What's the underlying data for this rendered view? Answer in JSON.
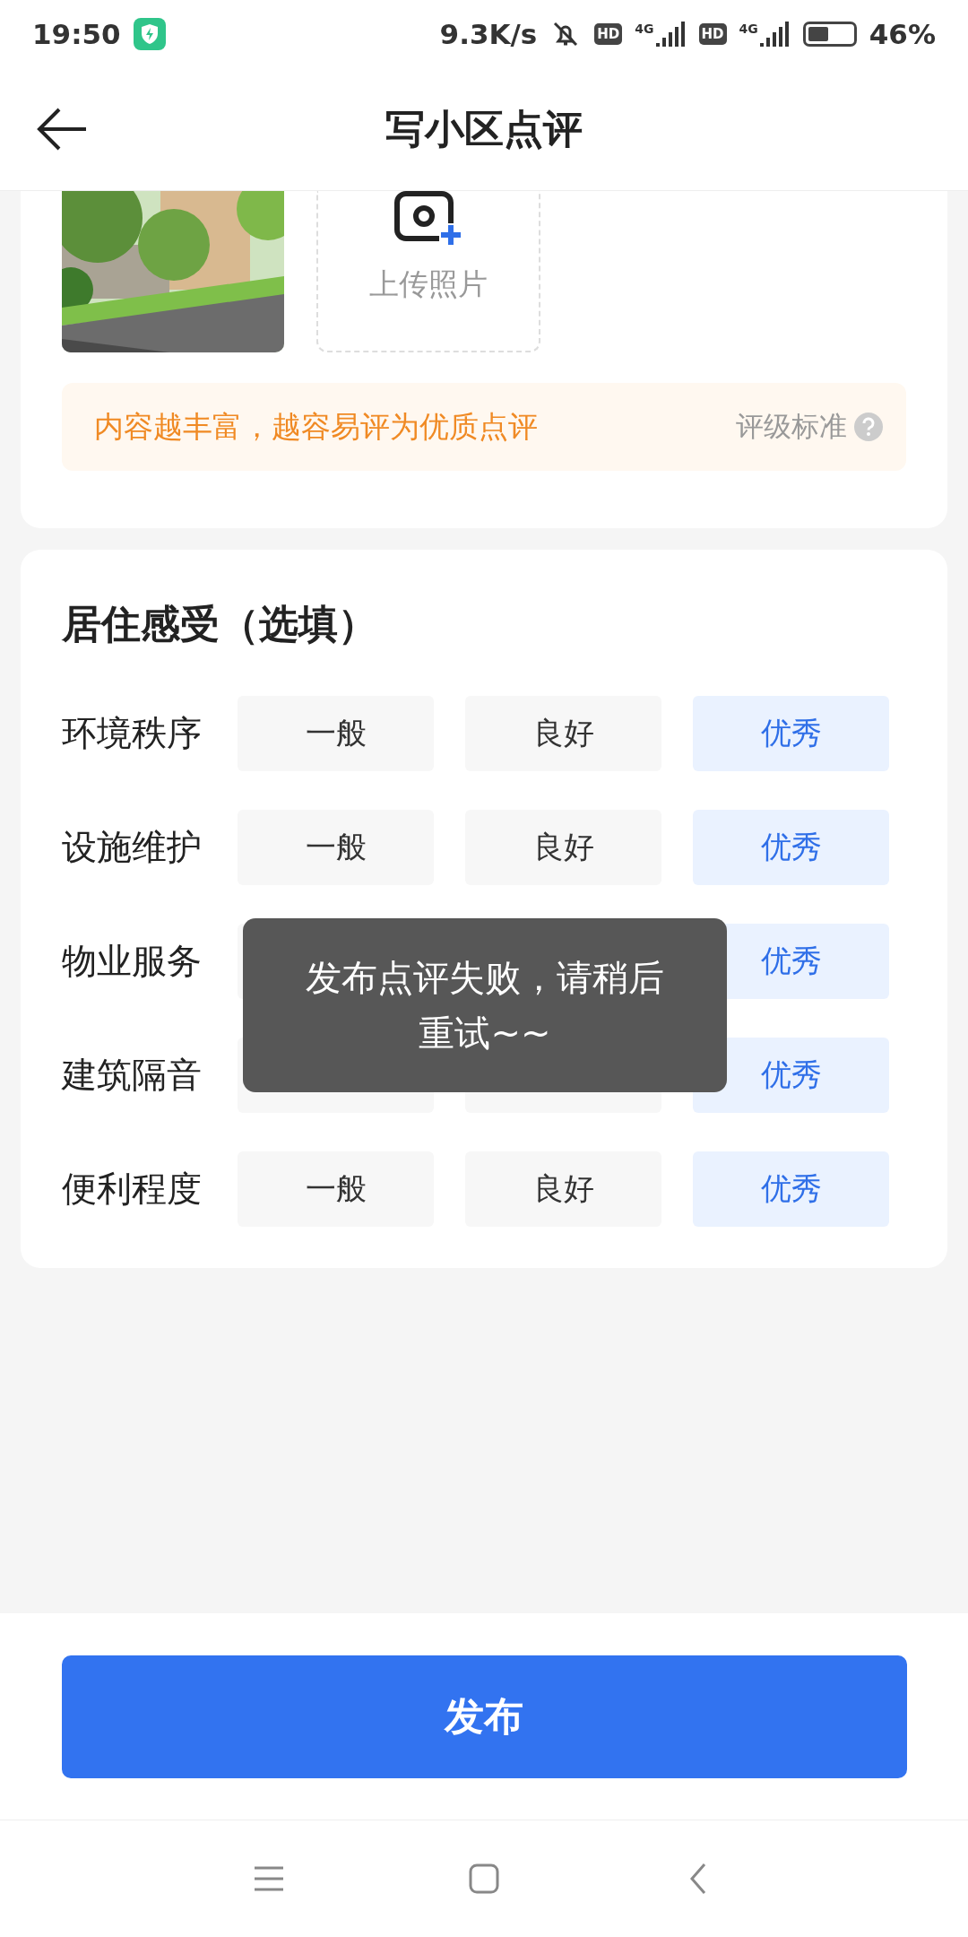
{
  "status_bar": {
    "time": "19:50",
    "speed": "9.3K/s",
    "hd_badges": [
      "HD",
      "HD"
    ],
    "network": [
      "4G",
      "4G"
    ],
    "battery": "46%"
  },
  "header": {
    "title": "写小区点评"
  },
  "upload": {
    "label": "上传照片"
  },
  "tip": {
    "text": "内容越丰富，越容易评为优质点评",
    "link": "评级标准"
  },
  "section": {
    "title": "居住感受（选填）"
  },
  "ratings": [
    {
      "label": "环境秩序",
      "options": [
        {
          "label": "一般",
          "selected": false
        },
        {
          "label": "良好",
          "selected": false
        },
        {
          "label": "优秀",
          "selected": true
        }
      ]
    },
    {
      "label": "设施维护",
      "options": [
        {
          "label": "一般",
          "selected": false
        },
        {
          "label": "良好",
          "selected": false
        },
        {
          "label": "优秀",
          "selected": true
        }
      ]
    },
    {
      "label": "物业服务",
      "options": [
        {
          "selected": false
        },
        {
          "label": "优秀",
          "selected": true
        }
      ]
    },
    {
      "label": "建筑隔音",
      "options": [
        {
          "selected": false
        },
        {
          "selected": false
        },
        {
          "label": "优秀",
          "selected": true
        }
      ]
    },
    {
      "label": "便利程度",
      "options": [
        {
          "label": "一般",
          "selected": false
        },
        {
          "label": "良好",
          "selected": false
        },
        {
          "label": "优秀",
          "selected": true
        }
      ]
    }
  ],
  "toast": {
    "message": "发布点评失败，请稍后重试~~"
  },
  "submit": {
    "label": "发布"
  }
}
